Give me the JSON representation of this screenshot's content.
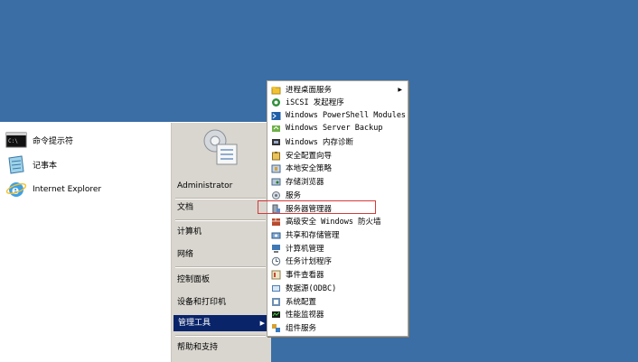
{
  "start_menu": {
    "pinned": [
      {
        "label": "命令提示符",
        "icon": "command-prompt-icon"
      },
      {
        "label": "记事本",
        "icon": "notepad-icon"
      },
      {
        "label": "Internet Explorer",
        "icon": "internet-explorer-icon"
      }
    ],
    "right": {
      "user": "Administrator",
      "items": [
        "文档",
        "计算机",
        "网络",
        "控制面板",
        "设备和打印机",
        "管理工具",
        "帮助和支持"
      ],
      "active": "管理工具"
    }
  },
  "submenu": {
    "items": [
      {
        "label": "进程桌面服务",
        "icon": "folder-icon",
        "has_submenu": true
      },
      {
        "label": "iSCSI 发起程序",
        "icon": "iscsi-icon"
      },
      {
        "label": "Windows PowerShell Modules",
        "icon": "powershell-icon"
      },
      {
        "label": "Windows Server Backup",
        "icon": "backup-icon"
      },
      {
        "label": "Windows 内存诊断",
        "icon": "memory-diagnostic-icon"
      },
      {
        "label": "安全配置向导",
        "icon": "security-wizard-icon"
      },
      {
        "label": "本地安全策略",
        "icon": "local-security-icon"
      },
      {
        "label": "存储浏览器",
        "icon": "storage-explorer-icon"
      },
      {
        "label": "服务",
        "icon": "services-icon"
      },
      {
        "label": "服务器管理器",
        "icon": "server-manager-icon",
        "highlighted": true
      },
      {
        "label": "高级安全 Windows 防火墙",
        "icon": "firewall-icon"
      },
      {
        "label": "共享和存储管理",
        "icon": "share-storage-icon"
      },
      {
        "label": "计算机管理",
        "icon": "computer-management-icon"
      },
      {
        "label": "任务计划程序",
        "icon": "task-scheduler-icon"
      },
      {
        "label": "事件查看器",
        "icon": "event-viewer-icon"
      },
      {
        "label": "数据源(ODBC)",
        "icon": "odbc-icon"
      },
      {
        "label": "系统配置",
        "icon": "system-config-icon"
      },
      {
        "label": "性能监视器",
        "icon": "performance-monitor-icon"
      },
      {
        "label": "组件服务",
        "icon": "component-services-icon"
      }
    ]
  },
  "colors": {
    "desktop": "#3a6ea5",
    "active": "#0a246a",
    "highlight_border": "#d43a3a"
  }
}
